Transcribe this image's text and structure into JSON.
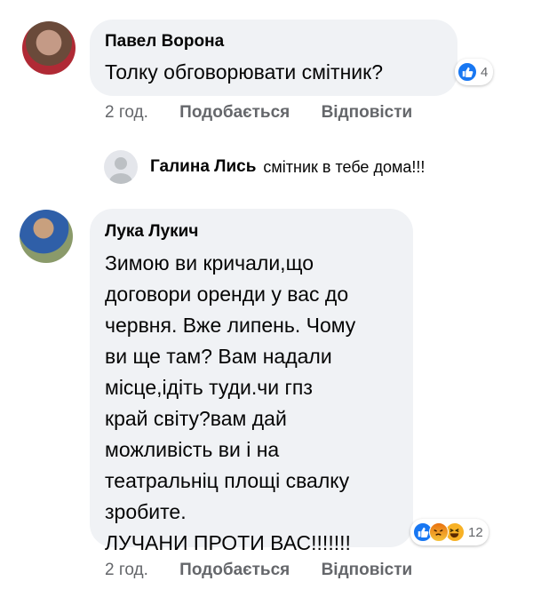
{
  "comments": [
    {
      "author": "Павел Ворона",
      "text": "Толку обговорювати смітник?",
      "reactions": {
        "count": "4"
      },
      "time": "2 год.",
      "like_label": "Подобається",
      "reply_label": "Відповісти"
    },
    {
      "author": "Лука Лукич",
      "text_lines": [
        "Зимою ви кричали,що",
        "договори оренди у вас до",
        "червня. Вже липень. Чому",
        "ви ще там? Вам надали",
        "місце,ідіть туди.чи гпз",
        "край світу?вам дай",
        "можливість ви і на",
        "театральніц площі свалку",
        "зробите.",
        "ЛУЧАНИ ПРОТИ ВАС!!!!!!!"
      ],
      "reactions": {
        "count": "12"
      },
      "time": "2 год.",
      "like_label": "Подобається",
      "reply_label": "Відповісти"
    }
  ],
  "reply": {
    "author": "Галина Лись",
    "text": "смітник в  тебе дома!!!"
  },
  "colors": {
    "bubble": "#f0f2f5",
    "like_blue": "#1877f2",
    "angry": "#e9710f",
    "haha": "#f7b125",
    "meta_gray": "#65676b"
  },
  "icons": [
    "like-icon",
    "angry-icon",
    "haha-icon",
    "default-avatar-icon"
  ]
}
